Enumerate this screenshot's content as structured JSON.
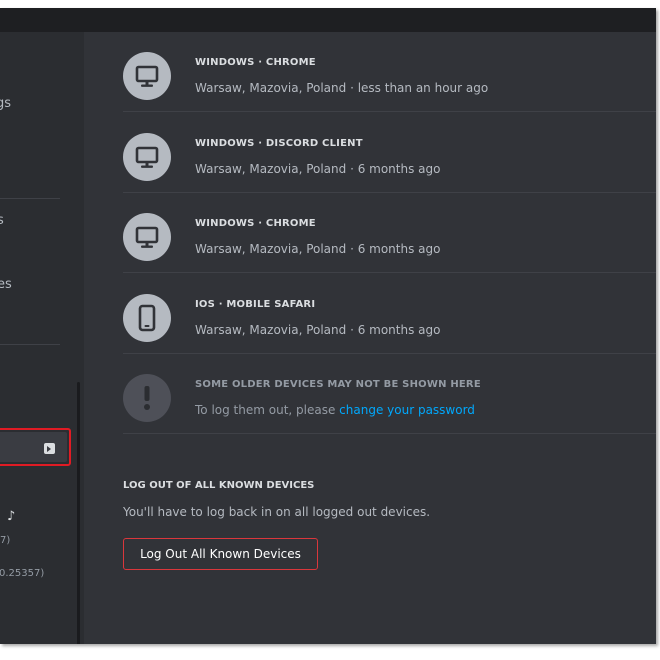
{
  "sidebar": {
    "partial_items": [
      "gs",
      "s",
      "es"
    ],
    "tiktok_glyph": "♪",
    "versions": [
      "7)",
      "0.25357)"
    ],
    "logout_icon": "logout-arrow-icon"
  },
  "devices": [
    {
      "title": "WINDOWS · CHROME",
      "subtitle": "Warsaw, Mazovia, Poland · less than an hour ago",
      "icon": "monitor-icon"
    },
    {
      "title": "WINDOWS · DISCORD CLIENT",
      "subtitle": "Warsaw, Mazovia, Poland · 6 months ago",
      "icon": "monitor-icon"
    },
    {
      "title": "WINDOWS · CHROME",
      "subtitle": "Warsaw, Mazovia, Poland · 6 months ago",
      "icon": "monitor-icon"
    },
    {
      "title": "IOS · MOBILE SAFARI",
      "subtitle": "Warsaw, Mazovia, Poland · 6 months ago",
      "icon": "phone-icon"
    }
  ],
  "older_note": {
    "title": "SOME OLDER DEVICES MAY NOT BE SHOWN HERE",
    "text": "To log them out, please ",
    "link": "change your password",
    "icon": "exclamation-icon"
  },
  "logout_all": {
    "title": "LOG OUT OF ALL KNOWN DEVICES",
    "description": "You'll have to log back in on all logged out devices.",
    "button_label": "Log Out All Known Devices"
  },
  "colors": {
    "background": "#313338",
    "sidebar": "#2b2d31",
    "accent_link": "#00a8fc",
    "danger": "#da373c",
    "highlight_box": "#e01b24"
  }
}
